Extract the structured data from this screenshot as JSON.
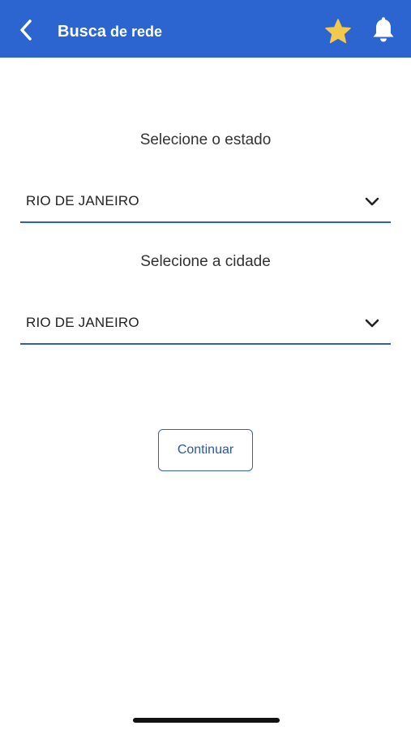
{
  "header": {
    "title_strong": "Busca",
    "title_rest": " de rede",
    "back_icon": "chevron-left-icon",
    "favorite_icon": "star-icon",
    "notifications_icon": "bell-icon",
    "background_color": "#2c65d0",
    "star_color": "#f2c94c"
  },
  "form": {
    "state_label": "Selecione o estado",
    "state_value": "RIO DE JANEIRO",
    "city_label": "Selecione a cidade",
    "city_value": "RIO DE JANEIRO",
    "dropdown_icon": "chevron-down-icon",
    "continue_label": "Continuar"
  }
}
